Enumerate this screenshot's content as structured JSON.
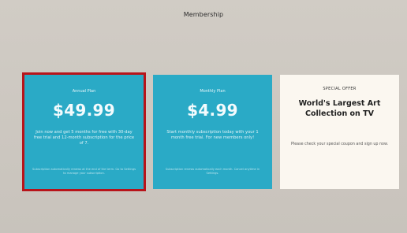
{
  "header": {
    "title": "Membership"
  },
  "plans": [
    {
      "id": "annual",
      "name": "Annual Plan",
      "price": "$49.99",
      "description": "Join now and get 5 months for free with 30-day free trial and 12-month subscription for the price of 7.",
      "fine_print": "Subscription automatically renews at the end of the term. Go to Settings to manage your subscription.",
      "selected": true
    },
    {
      "id": "monthly",
      "name": "Monthly Plan",
      "price": "$4.99",
      "description": "Start monthly subscription today with your 1 month free trial. For new members only!",
      "fine_print": "Subscription renews automatically each month. Cancel anytime in Settings.",
      "selected": false
    }
  ],
  "special_offer": {
    "tag": "SPECIAL OFFER",
    "title": "World's Largest Art Collection on TV",
    "description": "Please check your special coupon and sign up now."
  },
  "colors": {
    "background": "#cbc6bf",
    "teal_card": "#2aaac6",
    "cream_card": "#fbf7f0",
    "selection_outline": "#b8141a"
  }
}
